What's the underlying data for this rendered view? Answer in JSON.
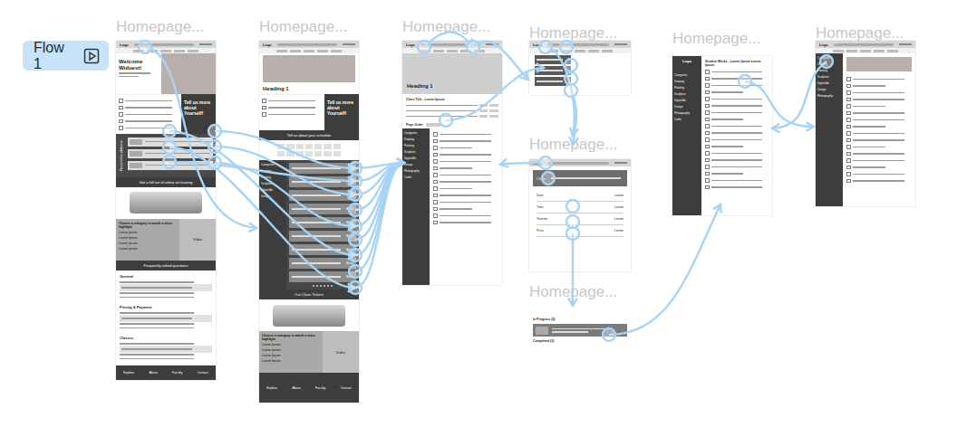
{
  "flow_badge": {
    "label": "Flow 1"
  },
  "frames": [
    {
      "title": "Homepage..."
    },
    {
      "title": "Homepage..."
    },
    {
      "title": "Homepage..."
    },
    {
      "title": "Homepage..."
    },
    {
      "title": "Homepage..."
    },
    {
      "title": "Homepage..."
    },
    {
      "title": "Homepage..."
    },
    {
      "title": "Homepage..."
    }
  ],
  "logo": "Logo",
  "home": {
    "welcome": "Welcome Widuest!",
    "prompt": "Tell us more about Yourself!",
    "recommendations": "Recommendations",
    "banner": "Get a full set of online art training",
    "category_title": "Choose a category to watch a class highlight",
    "categories": [
      "Lorem Ipsum",
      "Lorem Ipsum",
      "Lorem Ipsum",
      "Lorem Ipsum"
    ],
    "video": "Video",
    "faq_title": "Frequently asked questions",
    "faq_groups": [
      "General",
      "Pricing & Payment",
      "Classes"
    ],
    "footer": [
      "Explore",
      "About",
      "Faculty",
      "Contact"
    ]
  },
  "schedule": {
    "heading": "Heading 1",
    "prompt": "Tell us more about Yourself!",
    "band": "Tell us about your schedule",
    "sidebar": [
      "Categories",
      "Drawing",
      "Painting",
      "Sculpture",
      "Digital Art",
      "Design"
    ],
    "rows": [
      {
        "action": "Book"
      },
      {
        "action": "Book"
      },
      {
        "action": "Book"
      },
      {
        "action": "Book"
      },
      {
        "action": "Book"
      },
      {
        "action": "Book"
      },
      {
        "action": "Book"
      },
      {
        "action": "Book"
      },
      {
        "action": "Book"
      }
    ],
    "tickets": "Our Class Tickets",
    "category_title": "Choose a category to watch a class highlight",
    "categories": [
      "Lorem Ipsum",
      "Lorem Ipsum",
      "Lorem Ipsum",
      "Lorem Ipsum"
    ],
    "video": "Video",
    "footer": [
      "Explore",
      "About",
      "Faculty",
      "Contact"
    ]
  },
  "detail": {
    "heading": "Heading 1",
    "class_title": "Class Title - Lorem Ipsum",
    "page_order": "Page Order",
    "sidebar": [
      "Categories",
      "Drawing",
      "Painting",
      "Sculpture",
      "Digital Art",
      "Design",
      "Photography",
      "Crafts"
    ]
  },
  "booking": {
    "card": "Class",
    "rows": [
      {
        "label": "Date",
        "value": "Lorem"
      },
      {
        "label": "Time",
        "value": "Lorem"
      },
      {
        "label": "Teacher",
        "value": "Lorem"
      },
      {
        "label": "Price",
        "value": "Lorem"
      }
    ]
  },
  "progress": {
    "in_progress": "In Progress (2)",
    "completed": "Completed (3)"
  },
  "works": {
    "title": "Student Works - Lorem Ipsum Lorem Ipsum",
    "sidebar": [
      "Categories",
      "Drawing",
      "Painting",
      "Sculpture",
      "Digital Art",
      "Design",
      "Photography",
      "Crafts"
    ]
  },
  "gallery": {
    "sidebar": [
      "Categories",
      "Drawing",
      "Painting",
      "Sculpture",
      "Digital Art",
      "Design",
      "Photography"
    ]
  }
}
